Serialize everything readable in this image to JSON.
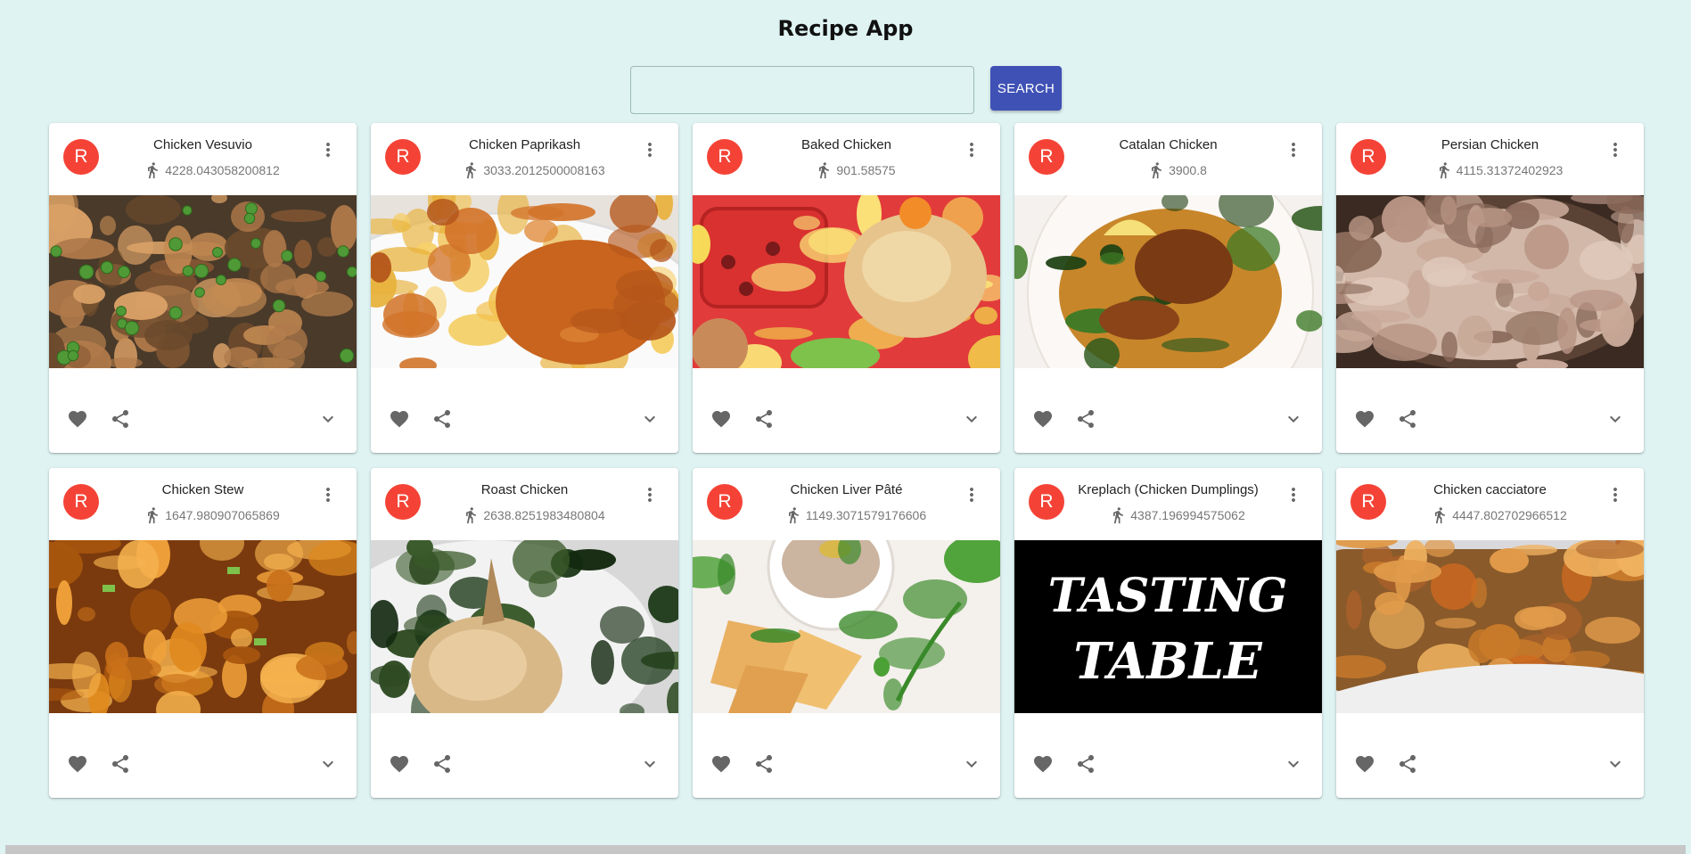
{
  "app": {
    "title": "Recipe App"
  },
  "search": {
    "value": "",
    "button_label": "SEARCH"
  },
  "colors": {
    "background": "#dff3f3",
    "accent": "#3f51b5",
    "avatar": "#f44336"
  },
  "recipes": [
    {
      "avatar": "R",
      "title": "Chicken Vesuvio",
      "calories": "4228.043058200812",
      "image": "vesuvio"
    },
    {
      "avatar": "R",
      "title": "Chicken Paprikash",
      "calories": "3033.2012500008163",
      "image": "paprikash"
    },
    {
      "avatar": "R",
      "title": "Baked Chicken",
      "calories": "901.58575",
      "image": "baked"
    },
    {
      "avatar": "R",
      "title": "Catalan Chicken",
      "calories": "3900.8",
      "image": "catalan"
    },
    {
      "avatar": "R",
      "title": "Persian Chicken",
      "calories": "4115.31372402923",
      "image": "persian"
    },
    {
      "avatar": "R",
      "title": "Chicken Stew",
      "calories": "1647.980907065869",
      "image": "stew"
    },
    {
      "avatar": "R",
      "title": "Roast Chicken",
      "calories": "2638.8251983480804",
      "image": "roast"
    },
    {
      "avatar": "R",
      "title": "Chicken Liver Pâté",
      "calories": "1149.3071579176606",
      "image": "pate"
    },
    {
      "avatar": "R",
      "title": "Kreplach (Chicken Dumplings)",
      "calories": "4387.196994575062",
      "image": "tasting-table",
      "image_text": [
        "TASTING",
        "TABLE"
      ]
    },
    {
      "avatar": "R",
      "title": "Chicken cacciatore",
      "calories": "4447.802702966512",
      "image": "cacciatore"
    }
  ],
  "icons": {
    "header": [
      "run-icon",
      "more-vert-icon"
    ],
    "actions": [
      "heart-icon",
      "share-icon",
      "chevron-down-icon"
    ]
  }
}
